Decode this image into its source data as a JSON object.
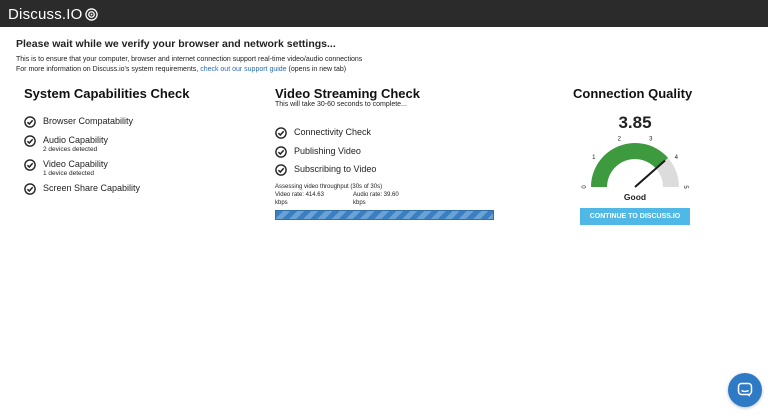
{
  "header": {
    "logo_text": "Discuss.IO"
  },
  "intro": {
    "title": "Please wait while we verify your browser and network settings...",
    "line1": "This is to ensure that your computer, browser and internet connection support real-time video/audio connections",
    "line2_prefix": "For more information on Discuss.io's system requirements, ",
    "line2_link": "check out our support guide",
    "line2_suffix": " (opens in new tab)"
  },
  "system": {
    "title": "System Capabilities Check",
    "items": [
      {
        "label": "Browser Compatability",
        "sub": ""
      },
      {
        "label": "Audio Capability",
        "sub": "2 devices detected"
      },
      {
        "label": "Video Capability",
        "sub": "1 device detected"
      },
      {
        "label": "Screen Share Capability",
        "sub": ""
      }
    ]
  },
  "streaming": {
    "title": "Video Streaming Check",
    "subtitle": "This will take 30-60 seconds to complete...",
    "items": [
      {
        "label": "Connectivity Check"
      },
      {
        "label": "Publishing Video"
      },
      {
        "label": "Subscribing to Video"
      }
    ],
    "assessing": "Assessing video throughput (30s of 30s)",
    "video_rate": "Video rate: 414.63",
    "video_unit": "kbps",
    "audio_rate": "Audio rate: 39.60",
    "audio_unit": "kbps",
    "progress": 1.0
  },
  "quality": {
    "title": "Connection Quality",
    "score": "3.85",
    "score_value": 3.85,
    "ticks": [
      "0",
      "1",
      "2",
      "3",
      "4",
      "5"
    ],
    "rating": "Good",
    "button_label": "CONTINUE TO DISCUSS.IO",
    "colors": {
      "fill": "#3e9a3e",
      "track": "#dcdcdc",
      "needle": "#1a1a1a"
    }
  },
  "colors": {
    "topbar": "#2b2b2b",
    "accent_button": "#4fb8e6",
    "progress": "#3c7fc0",
    "link": "#2a6db4",
    "chat": "#2f7ac4"
  },
  "icons": {
    "check": "check-circle-icon",
    "chat": "chat-bubble-icon",
    "logo": "target-icon"
  }
}
